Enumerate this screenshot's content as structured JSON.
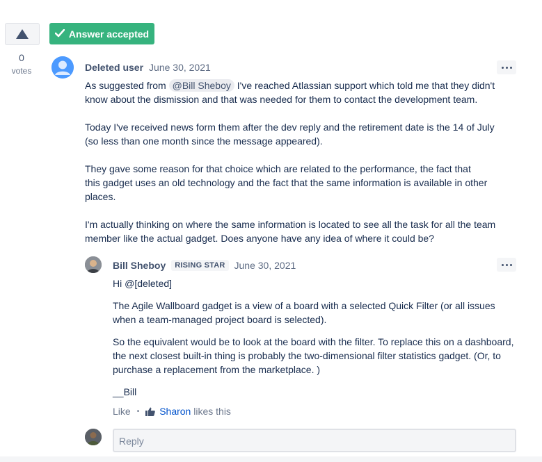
{
  "vote": {
    "count": "0",
    "label": "votes",
    "upvote_icon": "caret-up-icon"
  },
  "accepted_badge": {
    "label": "Answer accepted",
    "icon": "checkmark-icon",
    "color": "#36B37E"
  },
  "answer": {
    "author": "Deleted user",
    "date": "June 30, 2021",
    "para1_before": "As suggested from ",
    "mention": "@Bill Sheboy",
    "para1_after": " I've reached Atlassian support which told me that they didn't know about the dismission and that was needed for them to contact the development team.",
    "para2": "Today I've received news form them after the dev reply and the retirement date is the 14 of July (so less than one month since the message appeared).",
    "para3_line1": "They gave some reason for that choice which are related to the performance, the fact that",
    "para3_line2": "this gadget uses an old technology and the fact that the same information is available in other places.",
    "para4": "I'm actually thinking on where the same information is located to see all the task for all the team member like the actual gadget. Does anyone have any idea of where it could be?"
  },
  "comment": {
    "author": "Bill Sheboy",
    "badge": "RISING STAR",
    "date": "June 30, 2021",
    "greeting": "Hi @[deleted]",
    "para1": "The Agile Wallboard gadget is a view of a board with a selected Quick Filter (or all issues when a team-managed project board is selected).",
    "para2": "So the equivalent would be to look at the board with the filter.  To replace this on a dashboard, the next closest built-in thing is probably the two-dimensional filter statistics gadget.  (Or, to purchase a replacement from the marketplace. )",
    "signature": "__Bill",
    "like_label": "Like",
    "separator": "•",
    "liker": "Sharon",
    "likes_suffix": " likes this"
  },
  "reply": {
    "placeholder": "Reply"
  },
  "colors": {
    "accent": "#0052CC",
    "text": "#172B4D",
    "muted": "#6B778C"
  }
}
